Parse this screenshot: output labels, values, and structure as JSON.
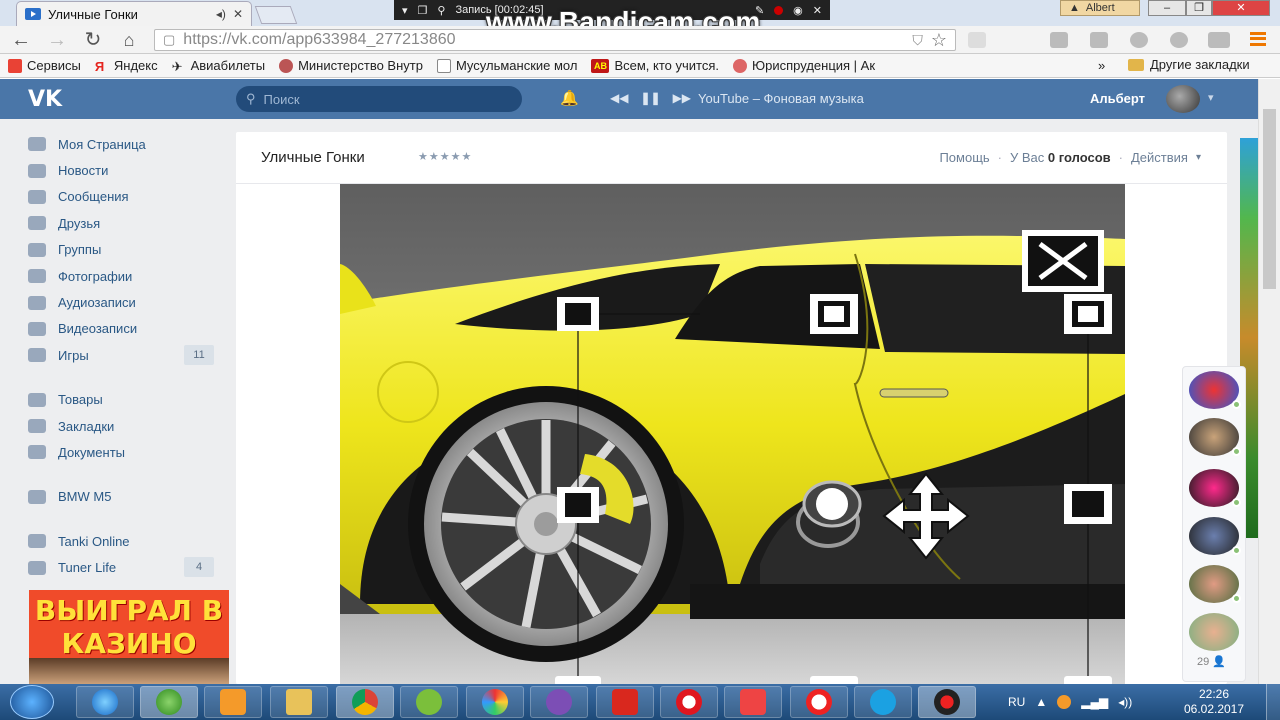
{
  "browser": {
    "tab_title": "Уличные Гонки",
    "url": "https://vk.com/app633984_277213860",
    "recorder_text": "Запись [00:02:45]",
    "watermark": "www.Bandicam.com",
    "profile_name": "Albert",
    "bookmarks": [
      {
        "label": "Сервисы",
        "color": "#e94235"
      },
      {
        "label": "Яндекс",
        "color": "#e52620"
      },
      {
        "label": "Авиабилеты",
        "color": "#222222"
      },
      {
        "label": "Министерство Внутр",
        "color": "#a33"
      },
      {
        "label": "Мусульманские мол",
        "color": "#888888"
      },
      {
        "label": "Всем, кто учится.",
        "color": "#c01818"
      },
      {
        "label": "Юриспруденция | Ак",
        "color": "#b44"
      }
    ],
    "bookmarks_more": "»",
    "other_bookmarks": "Другие закладки"
  },
  "vk": {
    "logo": "VK",
    "search_placeholder": "Поиск",
    "now_playing": "YouTube – Фоновая музыка",
    "user_name": "Альберт",
    "nav": [
      {
        "label": "Моя Страница",
        "icon": "home-icon"
      },
      {
        "label": "Новости",
        "icon": "news-icon"
      },
      {
        "label": "Сообщения",
        "icon": "messages-icon"
      },
      {
        "label": "Друзья",
        "icon": "friends-icon"
      },
      {
        "label": "Группы",
        "icon": "groups-icon"
      },
      {
        "label": "Фотографии",
        "icon": "camera-icon"
      },
      {
        "label": "Аудиозаписи",
        "icon": "music-icon"
      },
      {
        "label": "Видеозаписи",
        "icon": "video-icon"
      },
      {
        "label": "Игры",
        "icon": "gamepad-icon",
        "count": "11"
      }
    ],
    "nav2": [
      {
        "label": "Товары",
        "icon": "bag-icon"
      },
      {
        "label": "Закладки",
        "icon": "star-icon"
      },
      {
        "label": "Документы",
        "icon": "document-icon"
      }
    ],
    "nav3": [
      {
        "label": "BMW M5",
        "icon": "group-icon"
      }
    ],
    "nav4": [
      {
        "label": "Tanki Online",
        "icon": "app-grid-icon"
      },
      {
        "label": "Tuner Life",
        "icon": "car-icon",
        "count": "4"
      }
    ],
    "ad_text": "ВЫИГРАЛ В КАЗИНО",
    "app": {
      "name": "Уличные Гонки",
      "stars": "★★★★★",
      "help": "Помощь",
      "votes_prefix": "У Вас",
      "votes_count": "0 голосов",
      "actions": "Действия"
    },
    "friends_online_count": "29"
  },
  "taskbar": {
    "lang": "RU",
    "time": "22:26",
    "date": "06.02.2017"
  },
  "colors": {
    "vk_blue": "#4a76a8",
    "car_yellow": "#f2ea1a",
    "link": "#2a5885"
  }
}
